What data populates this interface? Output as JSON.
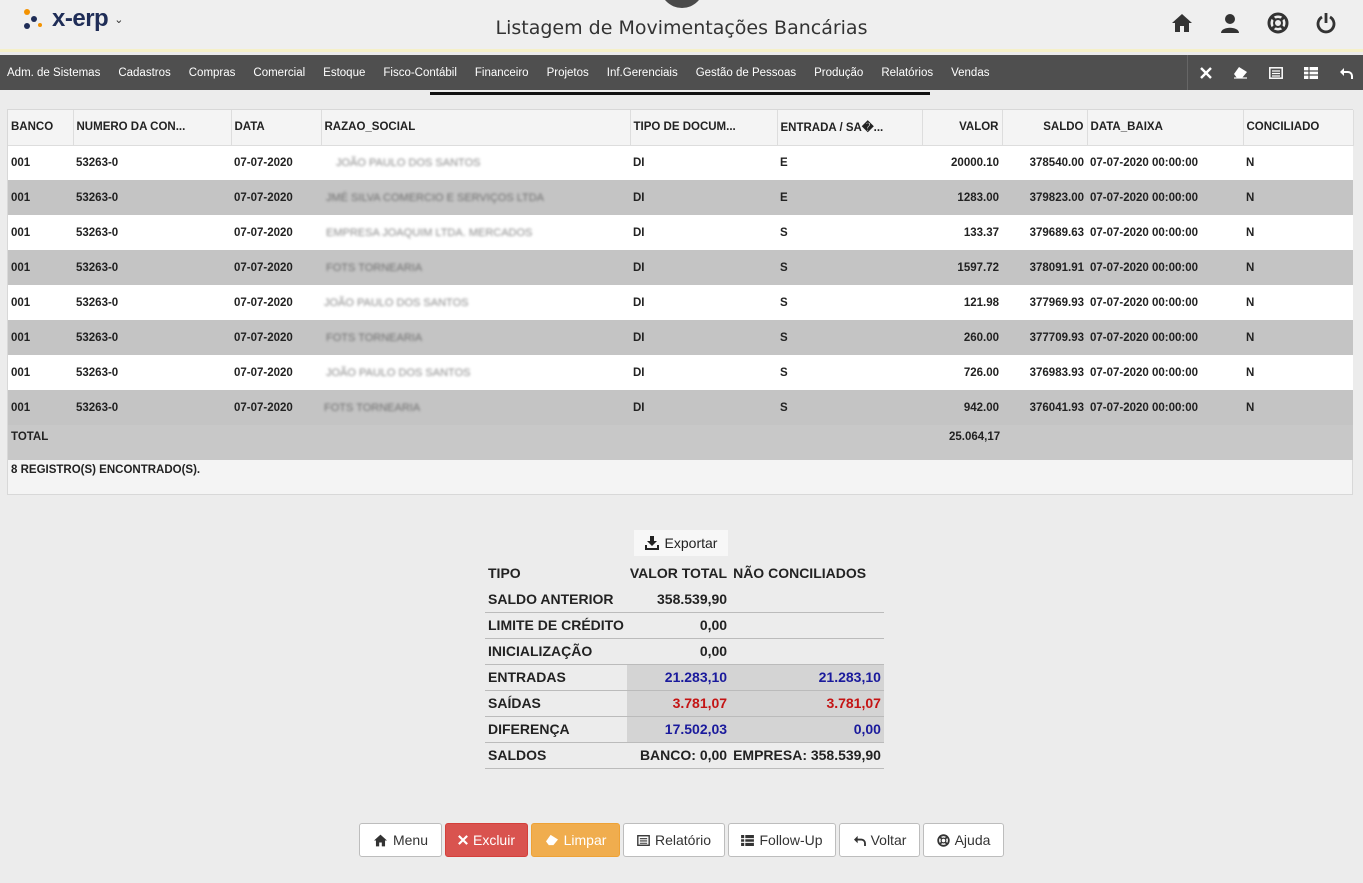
{
  "app": {
    "logo_text": "x-erp",
    "page_title": "Listagem de Movimentações Bancárias"
  },
  "header_icons": [
    "home-icon",
    "user-icon",
    "help-icon",
    "power-icon"
  ],
  "menu": {
    "items": [
      "Adm. de Sistemas",
      "Cadastros",
      "Compras",
      "Comercial",
      "Estoque",
      "Fisco-Contábil",
      "Financeiro",
      "Projetos",
      "Inf.Gerenciais",
      "Gestão de Pessoas",
      "Produção",
      "Relatórios",
      "Vendas"
    ],
    "tools": [
      "close-icon",
      "eraser-icon",
      "report-icon",
      "table-icon",
      "back-icon"
    ]
  },
  "grid": {
    "columns": [
      "BANCO",
      "NUMERO DA CON...",
      "DATA",
      "RAZAO_SOCIAL",
      "TIPO DE DOCUM...",
      "ENTRADA / SA�...",
      "VALOR",
      "SALDO",
      "DATA_BAIXA",
      "CONCILIADO"
    ],
    "rows": [
      [
        "001",
        "53263-0",
        "07-07-2020",
        "JOÃO PAULO DOS SANTOS",
        "DI",
        "E",
        "20000.10",
        "378540.00",
        "07-07-2020 00:00:00",
        "N"
      ],
      [
        "001",
        "53263-0",
        "07-07-2020",
        "JMÉ SILVA COMERCIO E SERVIÇOS LTDA",
        "DI",
        "E",
        "1283.00",
        "379823.00",
        "07-07-2020 00:00:00",
        "N"
      ],
      [
        "001",
        "53263-0",
        "07-07-2020",
        "EMPRESA JOAQUIM LTDA. MERCADOS",
        "DI",
        "S",
        "133.37",
        "379689.63",
        "07-07-2020 00:00:00",
        "N"
      ],
      [
        "001",
        "53263-0",
        "07-07-2020",
        "FOTS TORNEARIA",
        "DI",
        "S",
        "1597.72",
        "378091.91",
        "07-07-2020 00:00:00",
        "N"
      ],
      [
        "001",
        "53263-0",
        "07-07-2020",
        "JOÃO PAULO DOS SANTOS",
        "DI",
        "S",
        "121.98",
        "377969.93",
        "07-07-2020 00:00:00",
        "N"
      ],
      [
        "001",
        "53263-0",
        "07-07-2020",
        "FOTS TORNEARIA",
        "DI",
        "S",
        "260.00",
        "377709.93",
        "07-07-2020 00:00:00",
        "N"
      ],
      [
        "001",
        "53263-0",
        "07-07-2020",
        "JOÃO PAULO DOS SANTOS",
        "DI",
        "S",
        "726.00",
        "376983.93",
        "07-07-2020 00:00:00",
        "N"
      ],
      [
        "001",
        "53263-0",
        "07-07-2020",
        "FOTS TORNEARIA",
        "DI",
        "S",
        "942.00",
        "376041.93",
        "07-07-2020 00:00:00",
        "N"
      ]
    ],
    "total_label": "TOTAL",
    "total_value": "25.064,17",
    "records_text": "8 REGISTRO(S) ENCONTRADO(S)."
  },
  "export_label": "Exportar",
  "summary": {
    "headers": [
      "TIPO",
      "VALOR TOTAL",
      "NÃO CONCILIADOS"
    ],
    "rows": [
      {
        "tipo": "SALDO ANTERIOR",
        "total": "358.539,90",
        "nao": ""
      },
      {
        "tipo": "LIMITE DE CRÉDITO",
        "total": "0,00",
        "nao": ""
      },
      {
        "tipo": "INICIALIZAÇÃO",
        "total": "0,00",
        "nao": ""
      },
      {
        "tipo": "ENTRADAS",
        "total": "21.283,10",
        "nao": "21.283,10"
      },
      {
        "tipo": "SAÍDAS",
        "total": "3.781,07",
        "nao": "3.781,07"
      },
      {
        "tipo": "DIFERENÇA",
        "total": "17.502,03",
        "nao": "0,00"
      },
      {
        "tipo": "SALDOS",
        "total": "BANCO: 0,00",
        "nao": "EMPRESA: 358.539,90"
      }
    ]
  },
  "colors": {
    "entrada": "#1a1a9c",
    "saida": "#c41414",
    "excluir": "#d9534f",
    "limpar": "#f0ad4e",
    "menubar": "#4f4f4f"
  },
  "buttons": {
    "menu": "Menu",
    "excluir": "Excluir",
    "limpar": "Limpar",
    "relatorio": "Relatório",
    "followup": "Follow-Up",
    "voltar": "Voltar",
    "ajuda": "Ajuda"
  }
}
